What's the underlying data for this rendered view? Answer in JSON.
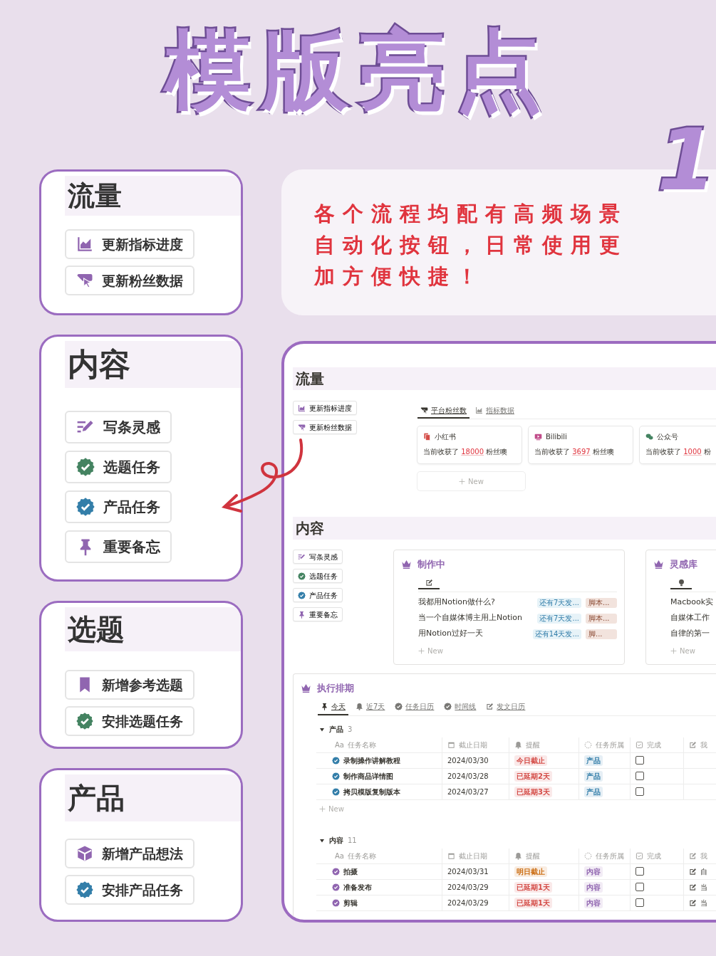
{
  "headline": "模版亮点",
  "badge_number": "1",
  "feature_cards": [
    {
      "title": "流量",
      "buttons": [
        "更新指标进度",
        "更新粉丝数据"
      ]
    },
    {
      "title": "内容",
      "buttons": [
        "写条灵感",
        "选题任务",
        "产品任务",
        "重要备忘"
      ]
    },
    {
      "title": "选题",
      "buttons": [
        "新增参考选题",
        "安排选题任务"
      ]
    },
    {
      "title": "产品",
      "buttons": [
        "新增产品想法",
        "安排产品任务"
      ]
    }
  ],
  "callout": {
    "lines": [
      "各个流程均配有高频场景",
      "自动化按钮，日常使用更",
      "加方便快捷！"
    ]
  },
  "notion": {
    "traffic": {
      "title": "流量",
      "buttons": [
        "更新指标进度",
        "更新粉丝数据"
      ],
      "tabs": [
        {
          "label": "平台粉丝数",
          "selected": true
        },
        {
          "label": "指标数据",
          "selected": false
        }
      ],
      "platforms": [
        {
          "name": "小红书",
          "prefix": "当前收获了",
          "count": "18000",
          "suffix": "粉丝噢"
        },
        {
          "name": "Bilibili",
          "prefix": "当前收获了",
          "count": "3697",
          "suffix": "粉丝噢"
        },
        {
          "name": "公众号",
          "prefix": "当前收获了",
          "count": "1000",
          "suffix": "粉"
        }
      ],
      "new_label": "New"
    },
    "content": {
      "title": "内容",
      "buttons": [
        "写条灵感",
        "选题任务",
        "产品任务",
        "重要备忘"
      ],
      "boards": [
        {
          "title": "制作中",
          "items": [
            {
              "title": "我都用Notion做什么?",
              "countdown": "还有7天发...",
              "stage": "脚本..."
            },
            {
              "title": "当一个自媒体博主用上Notion",
              "countdown": "还有7天发...",
              "stage": "脚本..."
            },
            {
              "title": "用Notion过好一天",
              "countdown": "还有14天发...",
              "stage": "脚..."
            }
          ],
          "new_label": "New"
        },
        {
          "title": "灵感库",
          "items": [
            {
              "title": "Macbook实"
            },
            {
              "title": "自媒体工作"
            },
            {
              "title": "自律的第一"
            }
          ],
          "new_label": "New"
        }
      ]
    },
    "schedule": {
      "title": "执行排期",
      "tabs": [
        {
          "label": "今天",
          "selected": true
        },
        {
          "label": "近7天",
          "selected": false
        },
        {
          "label": "任务日历",
          "selected": false
        },
        {
          "label": "时间线",
          "selected": false
        },
        {
          "label": "发文日历",
          "selected": false
        }
      ],
      "groups": [
        {
          "name": "产品",
          "count": "3",
          "expanded": true,
          "type_glyph": "Aa",
          "columns": [
            "任务名称",
            "截止日期",
            "提醒",
            "任务所属",
            "完成",
            "我"
          ],
          "new_label": "New",
          "rows": [
            {
              "name": "录制操作讲解教程",
              "due": "2024/03/30",
              "reminder": {
                "text": "今日截止",
                "color": "#d44c47"
              },
              "category": {
                "text": "产品",
                "color": "#337ea9"
              },
              "done": false
            },
            {
              "name": "制作商品详情图",
              "due": "2024/03/28",
              "reminder": {
                "text": "已延期2天",
                "color": "#d44c47"
              },
              "category": {
                "text": "产品",
                "color": "#337ea9"
              },
              "done": false
            },
            {
              "name": "拷贝模版复制版本",
              "due": "2024/03/27",
              "reminder": {
                "text": "已延期3天",
                "color": "#d44c47"
              },
              "category": {
                "text": "产品",
                "color": "#337ea9"
              },
              "done": false
            }
          ]
        },
        {
          "name": "内容",
          "count": "11",
          "expanded": true,
          "type_glyph": "Aa",
          "columns": [
            "任务名称",
            "截止日期",
            "提醒",
            "任务所属",
            "完成",
            "我"
          ],
          "rows": [
            {
              "name": "拍摄",
              "due": "2024/03/31",
              "reminder": {
                "text": "明日截止",
                "color": "#cb6d12"
              },
              "category": {
                "text": "内容",
                "color": "#9065b0"
              },
              "done": false,
              "note": "自"
            },
            {
              "name": "准备发布",
              "due": "2024/03/29",
              "reminder": {
                "text": "已延期1天",
                "color": "#d44c47"
              },
              "category": {
                "text": "内容",
                "color": "#9065b0"
              },
              "done": false,
              "note": "当"
            },
            {
              "name": "剪辑",
              "due": "2024/03/29",
              "reminder": {
                "text": "已延期1天",
                "color": "#d44c47"
              },
              "category": {
                "text": "内容",
                "color": "#9065b0"
              },
              "done": false,
              "note": "当"
            }
          ]
        }
      ]
    }
  }
}
